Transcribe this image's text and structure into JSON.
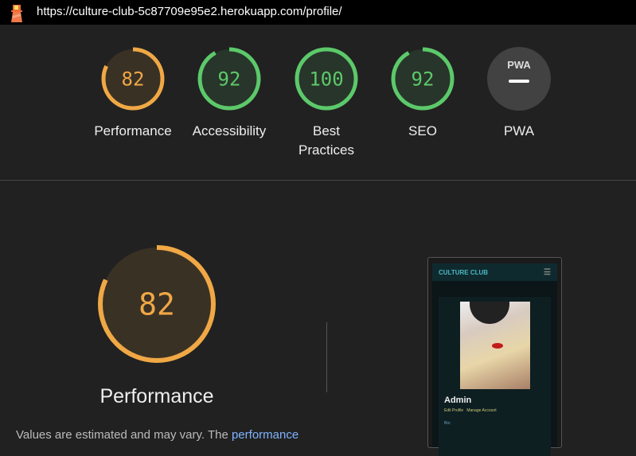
{
  "url": "https://culture-club-5c87709e95e2.herokuapp.com/profile/",
  "colors": {
    "orange": "#f0a845",
    "green": "#5cc96a",
    "gray": "#757575"
  },
  "gauges": [
    {
      "label": "Performance",
      "score": 82,
      "color": "orange"
    },
    {
      "label": "Accessibility",
      "score": 92,
      "color": "green"
    },
    {
      "label": "Best Practices",
      "score": 100,
      "color": "green"
    },
    {
      "label": "SEO",
      "score": 92,
      "color": "green"
    },
    {
      "label": "PWA",
      "score": null,
      "badge": "PWA",
      "color": "gray"
    }
  ],
  "main": {
    "score": 82,
    "label": "Performance",
    "note_prefix": "Values are estimated and may vary. The ",
    "note_link": "performance"
  },
  "screenshot": {
    "brand": "CULTURE CLUB",
    "name": "Admin",
    "edit": "Edit Profile",
    "manage": "Manage Account",
    "bio": "Bio:"
  }
}
